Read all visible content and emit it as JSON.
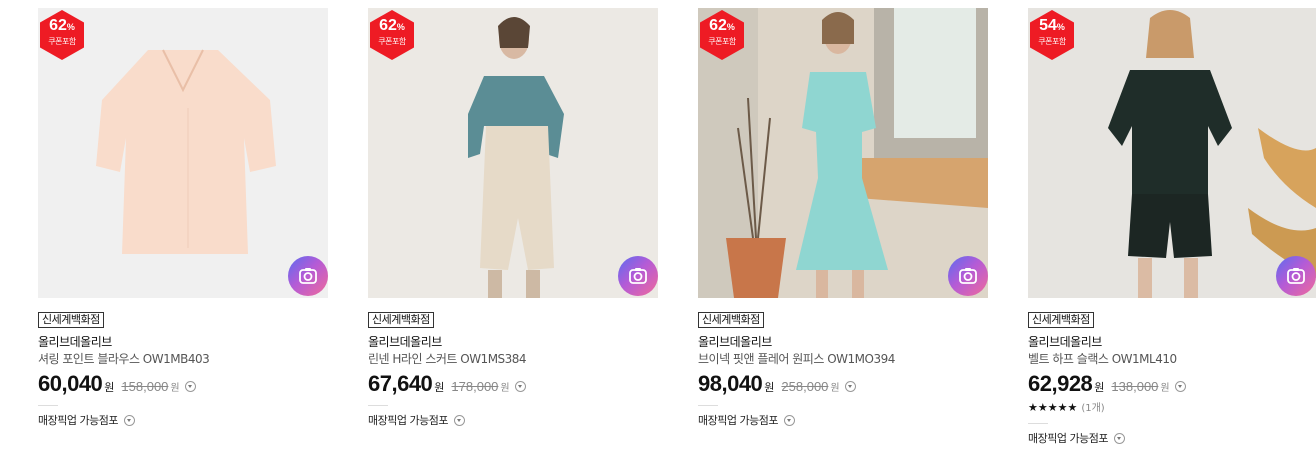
{
  "products": [
    {
      "discount": "62",
      "discount_unit": "%",
      "coupon_label": "쿠폰포함",
      "store": "신세계백화점",
      "brand": "올리브데올리브",
      "name": "셔링 포인트 블라우스 OW1MB403",
      "price": "60,040",
      "currency": "원",
      "original_price": "158,000",
      "pickup_label": "매장픽업 가능점포"
    },
    {
      "discount": "62",
      "discount_unit": "%",
      "coupon_label": "쿠폰포함",
      "store": "신세계백화점",
      "brand": "올리브데올리브",
      "name": "린넨 H라인 스커트 OW1MS384",
      "price": "67,640",
      "currency": "원",
      "original_price": "178,000",
      "pickup_label": "매장픽업 가능점포"
    },
    {
      "discount": "62",
      "discount_unit": "%",
      "coupon_label": "쿠폰포함",
      "store": "신세계백화점",
      "brand": "올리브데올리브",
      "name": "브이넥 핏앤 플레어 원피스 OW1MO394",
      "price": "98,040",
      "currency": "원",
      "original_price": "258,000",
      "pickup_label": "매장픽업 가능점포"
    },
    {
      "discount": "54",
      "discount_unit": "%",
      "coupon_label": "쿠폰포함",
      "store": "신세계백화점",
      "brand": "올리브데올리브",
      "name": "벨트 하프 슬랙스 OW1ML410",
      "price": "62,928",
      "currency": "원",
      "original_price": "138,000",
      "rating_stars": "★★★★★",
      "rating_count": "(1개)",
      "pickup_label": "매장픽업 가능점포"
    }
  ],
  "icons": {
    "camera": "camera-search-icon",
    "info": "chevron-circle-icon"
  },
  "colors": {
    "badge": "#ee1b24",
    "camera_gradient": [
      "#5b6cf0",
      "#b45bd6",
      "#f06a9b"
    ]
  }
}
